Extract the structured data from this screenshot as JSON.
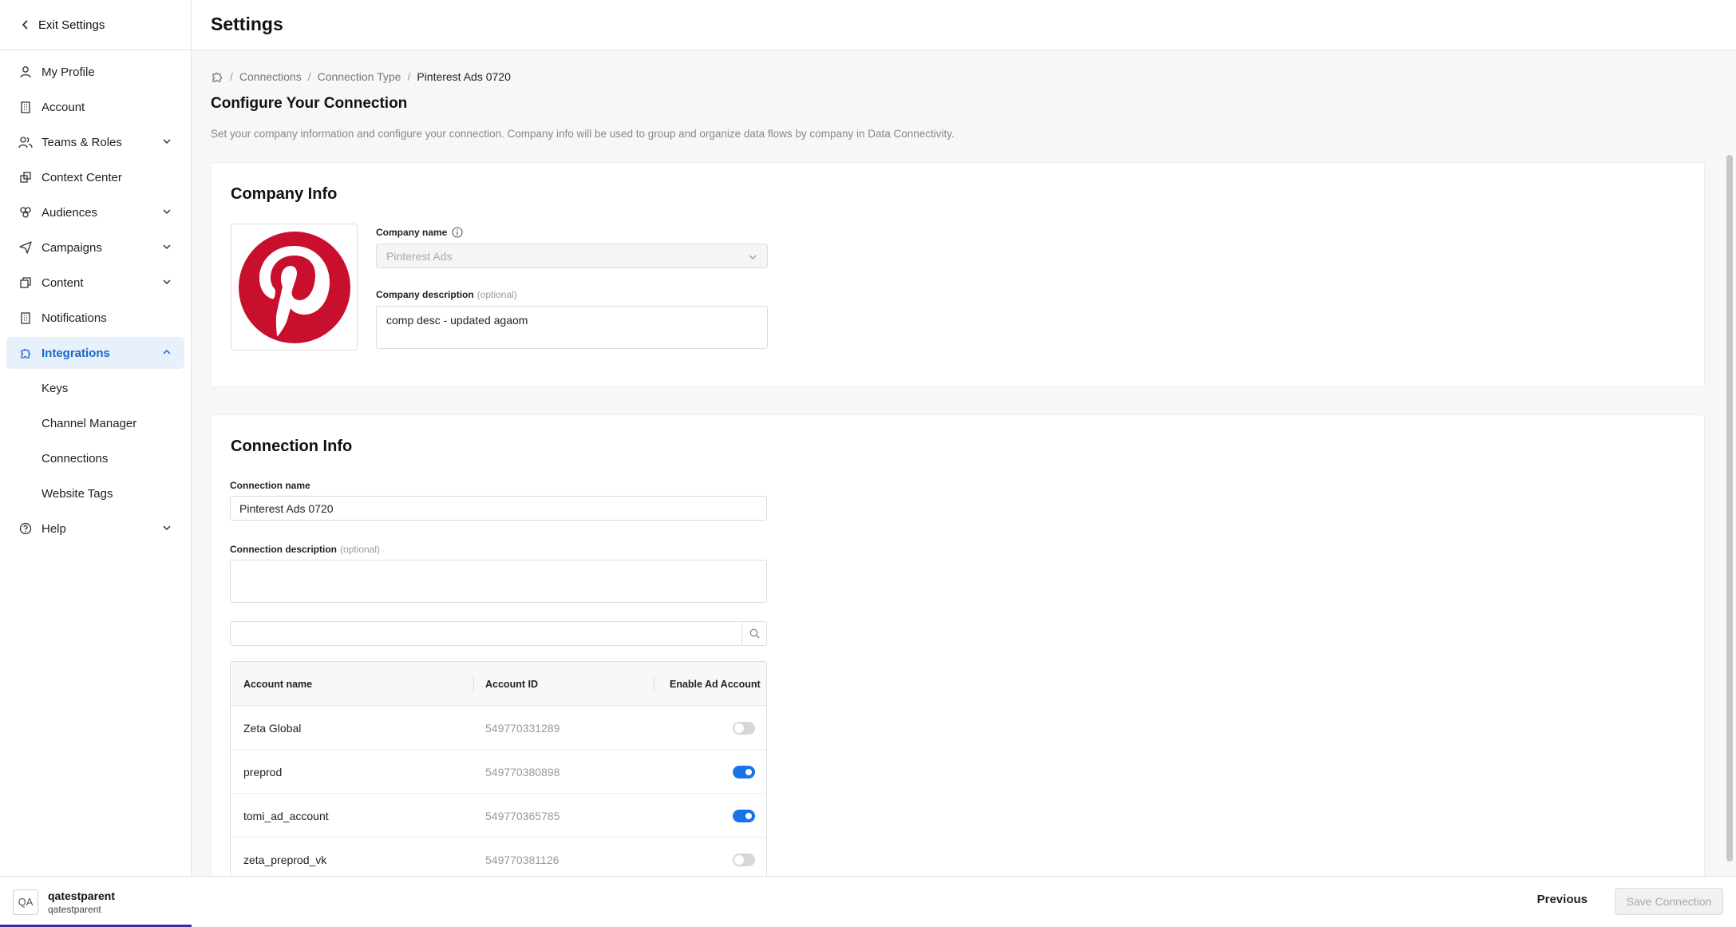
{
  "header": {
    "title": "Settings"
  },
  "sidebar": {
    "exit_label": "Exit Settings",
    "items": [
      {
        "label": "My Profile"
      },
      {
        "label": "Account"
      },
      {
        "label": "Teams & Roles"
      },
      {
        "label": "Context Center"
      },
      {
        "label": "Audiences"
      },
      {
        "label": "Campaigns"
      },
      {
        "label": "Content"
      },
      {
        "label": "Notifications"
      },
      {
        "label": "Integrations"
      },
      {
        "label": "Help"
      }
    ],
    "subitems": [
      {
        "label": "Keys"
      },
      {
        "label": "Channel Manager"
      },
      {
        "label": "Connections"
      },
      {
        "label": "Website Tags"
      }
    ],
    "user": {
      "initials": "QA",
      "name": "qatestparent",
      "org": "qatestparent"
    }
  },
  "breadcrumb": {
    "items": [
      "Connections",
      "Connection Type"
    ],
    "current": "Pinterest Ads 0720"
  },
  "page": {
    "title": "Configure Your Connection",
    "description": "Set your company information and configure your connection. Company info will be used to group and organize data flows by company in Data Connectivity."
  },
  "company": {
    "title": "Company Info",
    "name_label": "Company name",
    "name_value": "Pinterest Ads",
    "desc_label": "Company description",
    "optional": "(optional)",
    "desc_value": "comp desc - updated agaom"
  },
  "connection": {
    "title": "Connection Info",
    "name_label": "Connection name",
    "name_value": "Pinterest Ads 0720",
    "desc_label": "Connection description",
    "optional": "(optional)",
    "desc_value": "",
    "search_value": ""
  },
  "table": {
    "headers": [
      "Account name",
      "Account ID",
      "Enable Ad Account"
    ],
    "rows": [
      {
        "name": "Zeta Global",
        "id": "549770331289",
        "enabled": false
      },
      {
        "name": "preprod",
        "id": "549770380898",
        "enabled": true
      },
      {
        "name": "tomi_ad_account",
        "id": "549770365785",
        "enabled": true
      },
      {
        "name": "zeta_preprod_vk",
        "id": "549770381126",
        "enabled": false
      }
    ]
  },
  "footer": {
    "previous_label": "Previous",
    "save_label": "Save Connection"
  },
  "colors": {
    "accent": "#1a73e8",
    "active_bg": "#e8f1fb",
    "pinterest_red": "#c8102e"
  }
}
